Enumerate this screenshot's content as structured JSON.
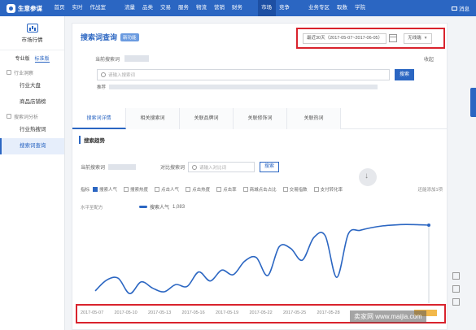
{
  "app": {
    "logo_text": "生意参谋"
  },
  "topnav": {
    "items": [
      "首页",
      "实时",
      "作战室",
      "流量",
      "品类",
      "交易",
      "服务",
      "物流",
      "营销",
      "财务",
      "市场",
      "竞争",
      "业务专区",
      "取数",
      "学院"
    ],
    "active": "市场",
    "messages": "消息"
  },
  "sidebar": {
    "header": "市场行情",
    "editions": [
      "专业版",
      "标准版"
    ],
    "active_edition": "标准版",
    "groups": [
      {
        "title": "行业洞察",
        "items": [
          "行业大盘",
          "商品店铺榜"
        ]
      },
      {
        "title": "搜索词分析",
        "items": [
          "行业热搜词",
          "搜索词查询"
        ]
      }
    ],
    "active_item": "搜索词查询"
  },
  "main": {
    "title": "搜索词查询",
    "title_badge": "新功能",
    "date_range": "最近30天（2017-05-07~2017-06-05）",
    "device": "无线端",
    "current_word_label": "当前搜索词",
    "collapse": "收起",
    "search_placeholder": "请输入搜索词",
    "search_button": "搜索",
    "recommend_label": "推荐"
  },
  "tabs": [
    "搜索词详情",
    "相关搜索词",
    "关联品牌词",
    "关联修饰词",
    "关联热词"
  ],
  "active_tab": "搜索词详情",
  "trend": {
    "section_title": "搜索趋势",
    "keyword_label": "当前搜索词",
    "compare_label": "对比搜索词",
    "compare_placeholder": "请输入对比词",
    "compare_button": "搜索",
    "metrics_label": "指标",
    "metrics": [
      {
        "label": "搜索人气",
        "checked": true
      },
      {
        "label": "搜索热度",
        "checked": false
      },
      {
        "label": "点击人气",
        "checked": false
      },
      {
        "label": "点击热度",
        "checked": false
      },
      {
        "label": "点击率",
        "checked": false
      },
      {
        "label": "商城点击占比",
        "checked": false
      },
      {
        "label": "交易指数",
        "checked": false
      },
      {
        "label": "支付转化率",
        "checked": false
      }
    ],
    "max_hint": "还能添加1项",
    "method_label": "水平至配方",
    "legend_name": "搜索人气",
    "legend_value": "1,083"
  },
  "chart_data": {
    "type": "line",
    "x": [
      "2017-05-07",
      "2017-05-08",
      "2017-05-09",
      "2017-05-10",
      "2017-05-11",
      "2017-05-12",
      "2017-05-13",
      "2017-05-14",
      "2017-05-15",
      "2017-05-16",
      "2017-05-17",
      "2017-05-18",
      "2017-05-19",
      "2017-05-20",
      "2017-05-21",
      "2017-05-22",
      "2017-05-23",
      "2017-05-24",
      "2017-05-25",
      "2017-05-26",
      "2017-05-27",
      "2017-05-28",
      "2017-05-29",
      "2017-05-30",
      "2017-05-31",
      "2017-06-01",
      "2017-06-02",
      "2017-06-03",
      "2017-06-04",
      "2017-06-05"
    ],
    "tick_labels": [
      "2017-05-07",
      "2017-05-10",
      "2017-05-13",
      "2017-05-16",
      "2017-05-19",
      "2017-05-22",
      "2017-05-25",
      "2017-05-28"
    ],
    "series": [
      {
        "name": "搜索人气",
        "values": [
          350,
          470,
          490,
          320,
          450,
          380,
          340,
          420,
          400,
          560,
          460,
          580,
          530,
          680,
          720,
          520,
          840,
          820,
          690,
          940,
          960,
          500,
          980,
          1020,
          1050,
          1070,
          1080,
          1085,
          1083,
          1078
        ]
      }
    ],
    "ylim": [
      250,
      1150
    ],
    "grid": false,
    "legend": "top-left"
  },
  "watermark": "卖家网 www.maijia.com",
  "colors": {
    "brand": "#2b66c2",
    "highlight": "#d9232d",
    "topbar": "#2b66c2"
  }
}
